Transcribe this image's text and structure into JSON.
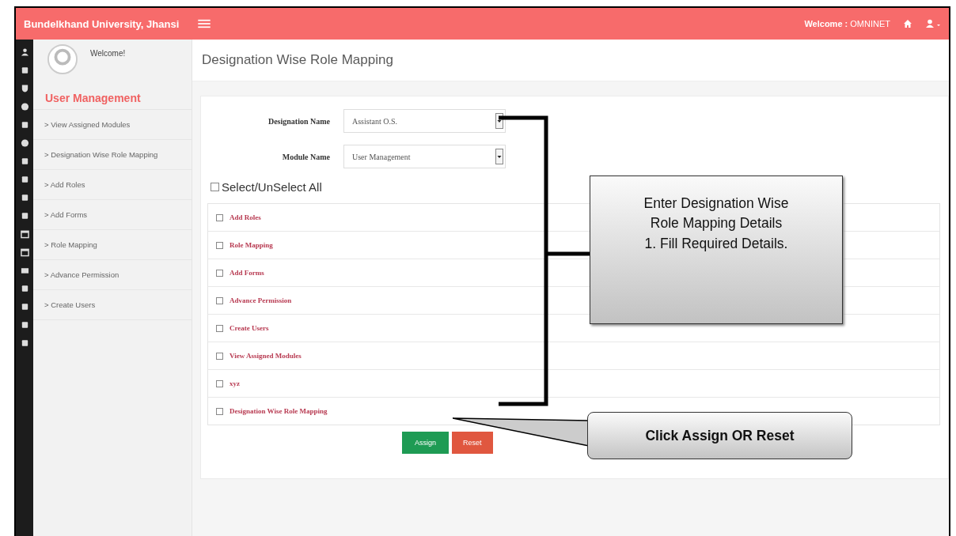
{
  "header": {
    "title": "Bundelkhand University, Jhansi",
    "welcome_label": "Welcome :",
    "user": "OMNINET"
  },
  "sidebar": {
    "greeting": "Welcome!",
    "section": "User Management",
    "items": [
      {
        "label": "> View Assigned Modules"
      },
      {
        "label": "> Designation Wise Role Mapping"
      },
      {
        "label": "> Add Roles"
      },
      {
        "label": "> Add Forms"
      },
      {
        "label": "> Role Mapping"
      },
      {
        "label": "> Advance Permission"
      },
      {
        "label": "> Create Users"
      }
    ]
  },
  "page_title": "Designation Wise Role Mapping",
  "form": {
    "fields": [
      {
        "label": "Designation Name",
        "value": "Assistant O.S."
      },
      {
        "label": "Module Name",
        "value": "User Management"
      }
    ],
    "select_all": {
      "label": "Select/UnSelect All",
      "checked": false
    },
    "roles": [
      {
        "label": "Add Roles",
        "checked": false
      },
      {
        "label": "Role Mapping",
        "checked": false
      },
      {
        "label": "Add Forms",
        "checked": false
      },
      {
        "label": "Advance Permission",
        "checked": false
      },
      {
        "label": "Create Users",
        "checked": false
      },
      {
        "label": "View Assigned Modules",
        "checked": false
      },
      {
        "label": "xyz",
        "checked": false
      },
      {
        "label": "Designation Wise Role Mapping",
        "checked": false
      }
    ],
    "buttons": [
      {
        "label": "Assign",
        "kind": "primary"
      },
      {
        "label": "Reset",
        "kind": "danger"
      }
    ]
  },
  "callouts": [
    {
      "kind": "box",
      "lines": [
        "Enter Designation Wise",
        "Role Mapping Details",
        "1. Fill Required Details."
      ]
    },
    {
      "kind": "pointer",
      "lines": [
        "Click Assign OR Reset"
      ]
    }
  ]
}
